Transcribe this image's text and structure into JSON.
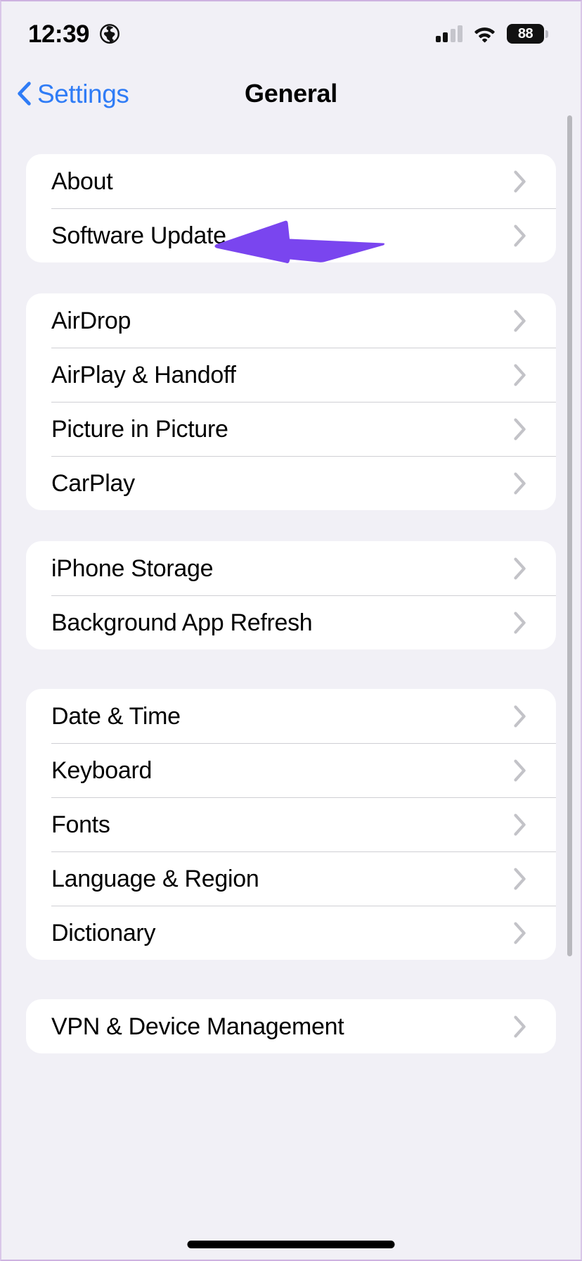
{
  "status_bar": {
    "time": "12:39",
    "location_icon": "globe-icon",
    "cellular_icon": "signal-bars-icon",
    "wifi_icon": "wifi-icon",
    "battery_level": "88"
  },
  "nav": {
    "back_label": "Settings",
    "back_icon": "chevron-left-icon",
    "title": "General"
  },
  "annotation": {
    "type": "arrow-left",
    "color": "#7a45ef",
    "points_at": "Software Update"
  },
  "colors": {
    "background": "#f1f0f6",
    "card": "#ffffff",
    "accent_blue": "#2f7cf6",
    "separator": "#cfcfd4",
    "chevron": "#c3c3c8",
    "annotation_purple": "#7a45ef"
  },
  "groups": [
    {
      "rows": [
        {
          "label": "About",
          "accessory": "chevron-right-icon"
        },
        {
          "label": "Software Update",
          "accessory": "chevron-right-icon"
        }
      ]
    },
    {
      "rows": [
        {
          "label": "AirDrop",
          "accessory": "chevron-right-icon"
        },
        {
          "label": "AirPlay & Handoff",
          "accessory": "chevron-right-icon"
        },
        {
          "label": "Picture in Picture",
          "accessory": "chevron-right-icon"
        },
        {
          "label": "CarPlay",
          "accessory": "chevron-right-icon"
        }
      ]
    },
    {
      "rows": [
        {
          "label": "iPhone Storage",
          "accessory": "chevron-right-icon"
        },
        {
          "label": "Background App Refresh",
          "accessory": "chevron-right-icon"
        }
      ]
    },
    {
      "rows": [
        {
          "label": "Date & Time",
          "accessory": "chevron-right-icon"
        },
        {
          "label": "Keyboard",
          "accessory": "chevron-right-icon"
        },
        {
          "label": "Fonts",
          "accessory": "chevron-right-icon"
        },
        {
          "label": "Language & Region",
          "accessory": "chevron-right-icon"
        },
        {
          "label": "Dictionary",
          "accessory": "chevron-right-icon"
        }
      ]
    },
    {
      "rows": [
        {
          "label": "VPN & Device Management",
          "accessory": "chevron-right-icon"
        }
      ]
    }
  ]
}
